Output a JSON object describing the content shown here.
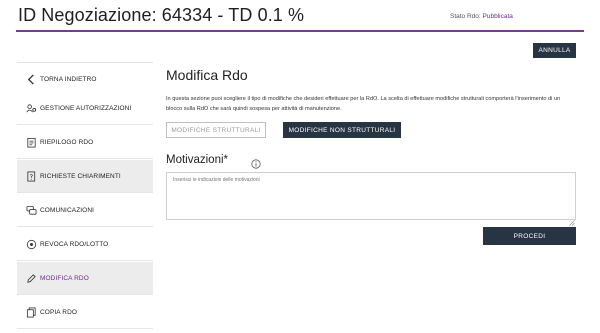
{
  "header": {
    "title": "ID Negoziazione: 64334 - TD 0.1 %",
    "stato_label": "Stato Rdo:",
    "stato_value": "Pubblicata"
  },
  "actions": {
    "annulla": "ANNULLA"
  },
  "sidebar": {
    "items": [
      {
        "label": "TORNA INDIETRO",
        "icon": "chevron-left-icon"
      },
      {
        "label": "GESTIONE AUTORIZZAZIONI",
        "icon": "users-gear-icon"
      },
      {
        "label": "RIEPILOGO RDO",
        "icon": "clipboard-icon"
      },
      {
        "label": "RICHIESTE CHIARIMENTI",
        "icon": "document-question-icon"
      },
      {
        "label": "COMUNICAZIONI",
        "icon": "chat-icon"
      },
      {
        "label": "REVOCA RDO/LOTTO",
        "icon": "revoke-icon"
      },
      {
        "label": "MODIFICA RDO",
        "icon": "edit-icon"
      },
      {
        "label": "COPIA RDO",
        "icon": "copy-icon"
      }
    ]
  },
  "main": {
    "title": "Modifica Rdo",
    "intro": "In questa sezione puoi scegliere il tipo di modifiche che desideri effettuare per la RdO. La scelta di effettuare modifiche strutturali comporterà l'inserimento di un blocco sulla RdO che sarà quindi sospesa per attività di manutenzione.",
    "btn_strutturali": "MODIFICHE STRUTTURALI",
    "btn_non_strutturali": "MODIFICHE NON STRUTTURALI",
    "motivazioni_label": "Motivazioni*",
    "motivazioni_placeholder": "Inserisci le indicazioni delle motivazioni",
    "procedi": "PROCEDI"
  },
  "colors": {
    "accent": "#7a3a8e",
    "button_dark": "#273444",
    "sidebar_highlight": "#ececec"
  }
}
